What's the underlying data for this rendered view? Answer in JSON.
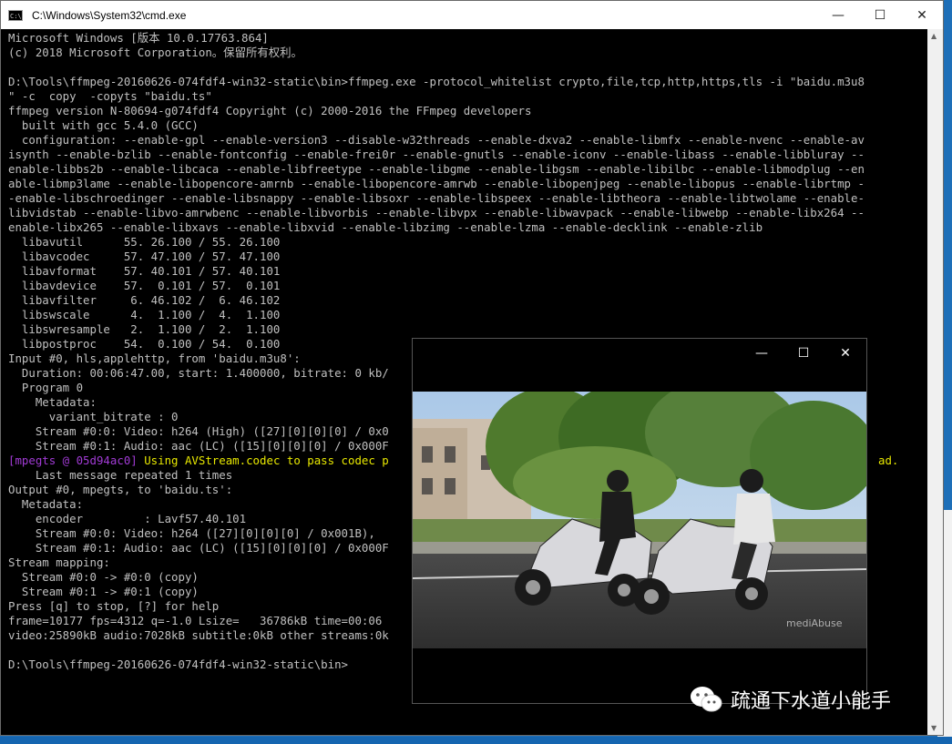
{
  "window": {
    "title": "C:\\Windows\\System32\\cmd.exe",
    "icon_text": "C:\\",
    "controls": {
      "minimize": "—",
      "maximize": "☐",
      "close": "✕"
    }
  },
  "console": {
    "lines": [
      {
        "text": "Microsoft Windows [版本 10.0.17763.864]"
      },
      {
        "text": "(c) 2018 Microsoft Corporation。保留所有权利。"
      },
      {
        "text": ""
      },
      {
        "text": "D:\\Tools\\ffmpeg-20160626-074fdf4-win32-static\\bin>ffmpeg.exe -protocol_whitelist crypto,file,tcp,http,https,tls -i \"baidu.m3u8"
      },
      {
        "text": "\" -c  copy  -copyts \"baidu.ts\""
      },
      {
        "text": "ffmpeg version N-80694-g074fdf4 Copyright (c) 2000-2016 the FFmpeg developers"
      },
      {
        "text": "  built with gcc 5.4.0 (GCC)"
      },
      {
        "text": "  configuration: --enable-gpl --enable-version3 --disable-w32threads --enable-dxva2 --enable-libmfx --enable-nvenc --enable-av"
      },
      {
        "text": "isynth --enable-bzlib --enable-fontconfig --enable-frei0r --enable-gnutls --enable-iconv --enable-libass --enable-libbluray --"
      },
      {
        "text": "enable-libbs2b --enable-libcaca --enable-libfreetype --enable-libgme --enable-libgsm --enable-libilbc --enable-libmodplug --en"
      },
      {
        "text": "able-libmp3lame --enable-libopencore-amrnb --enable-libopencore-amrwb --enable-libopenjpeg --enable-libopus --enable-librtmp -"
      },
      {
        "text": "-enable-libschroedinger --enable-libsnappy --enable-libsoxr --enable-libspeex --enable-libtheora --enable-libtwolame --enable-"
      },
      {
        "text": "libvidstab --enable-libvo-amrwbenc --enable-libvorbis --enable-libvpx --enable-libwavpack --enable-libwebp --enable-libx264 --"
      },
      {
        "text": "enable-libx265 --enable-libxavs --enable-libxvid --enable-libzimg --enable-lzma --enable-decklink --enable-zlib"
      },
      {
        "text": "  libavutil      55. 26.100 / 55. 26.100"
      },
      {
        "text": "  libavcodec     57. 47.100 / 57. 47.100"
      },
      {
        "text": "  libavformat    57. 40.101 / 57. 40.101"
      },
      {
        "text": "  libavdevice    57.  0.101 / 57.  0.101"
      },
      {
        "text": "  libavfilter     6. 46.102 /  6. 46.102"
      },
      {
        "text": "  libswscale      4.  1.100 /  4.  1.100"
      },
      {
        "text": "  libswresample   2.  1.100 /  2.  1.100"
      },
      {
        "text": "  libpostproc    54.  0.100 / 54.  0.100"
      },
      {
        "text": "Input #0, hls,applehttp, from 'baidu.m3u8':"
      },
      {
        "text": "  Duration: 00:06:47.00, start: 1.400000, bitrate: 0 kb/"
      },
      {
        "text": "  Program 0"
      },
      {
        "text": "    Metadata:"
      },
      {
        "text": "      variant_bitrate : 0"
      },
      {
        "text": "    Stream #0:0: Video: h264 (High) ([27][0][0][0] / 0x0"
      },
      {
        "text": "    Stream #0:1: Audio: aac (LC) ([15][0][0][0] / 0x000F"
      },
      {
        "tag": "[mpegts @ 05d94ac0] ",
        "text": "Using AVStream.codec to pass codec p",
        "tail": "ad."
      },
      {
        "text": "    Last message repeated 1 times"
      },
      {
        "text": "Output #0, mpegts, to 'baidu.ts':"
      },
      {
        "text": "  Metadata:"
      },
      {
        "text": "    encoder         : Lavf57.40.101"
      },
      {
        "text": "    Stream #0:0: Video: h264 ([27][0][0][0] / 0x001B), "
      },
      {
        "text": "    Stream #0:1: Audio: aac (LC) ([15][0][0][0] / 0x000F"
      },
      {
        "text": "Stream mapping:"
      },
      {
        "text": "  Stream #0:0 -> #0:0 (copy)"
      },
      {
        "text": "  Stream #0:1 -> #0:1 (copy)"
      },
      {
        "text": "Press [q] to stop, [?] for help"
      },
      {
        "text": "frame=10177 fps=4312 q=-1.0 Lsize=   36786kB time=00:06"
      },
      {
        "text": "video:25890kB audio:7028kB subtitle:0kB other streams:0k"
      },
      {
        "text": ""
      },
      {
        "text": "D:\\Tools\\ffmpeg-20160626-074fdf4-win32-static\\bin>"
      }
    ]
  },
  "scrollbar": {
    "up": "▲",
    "down": "▼"
  },
  "video_window": {
    "controls": {
      "minimize": "—",
      "maximize": "☐",
      "close": "✕"
    },
    "logo_text": "mediAbuse"
  },
  "watermark": {
    "text": "疏通下水道小能手"
  },
  "colors": {
    "console_bg": "#000000",
    "console_text": "#c0c0c0",
    "tag_purple": "#a23bd6",
    "warning_yellow": "#e8e800"
  }
}
